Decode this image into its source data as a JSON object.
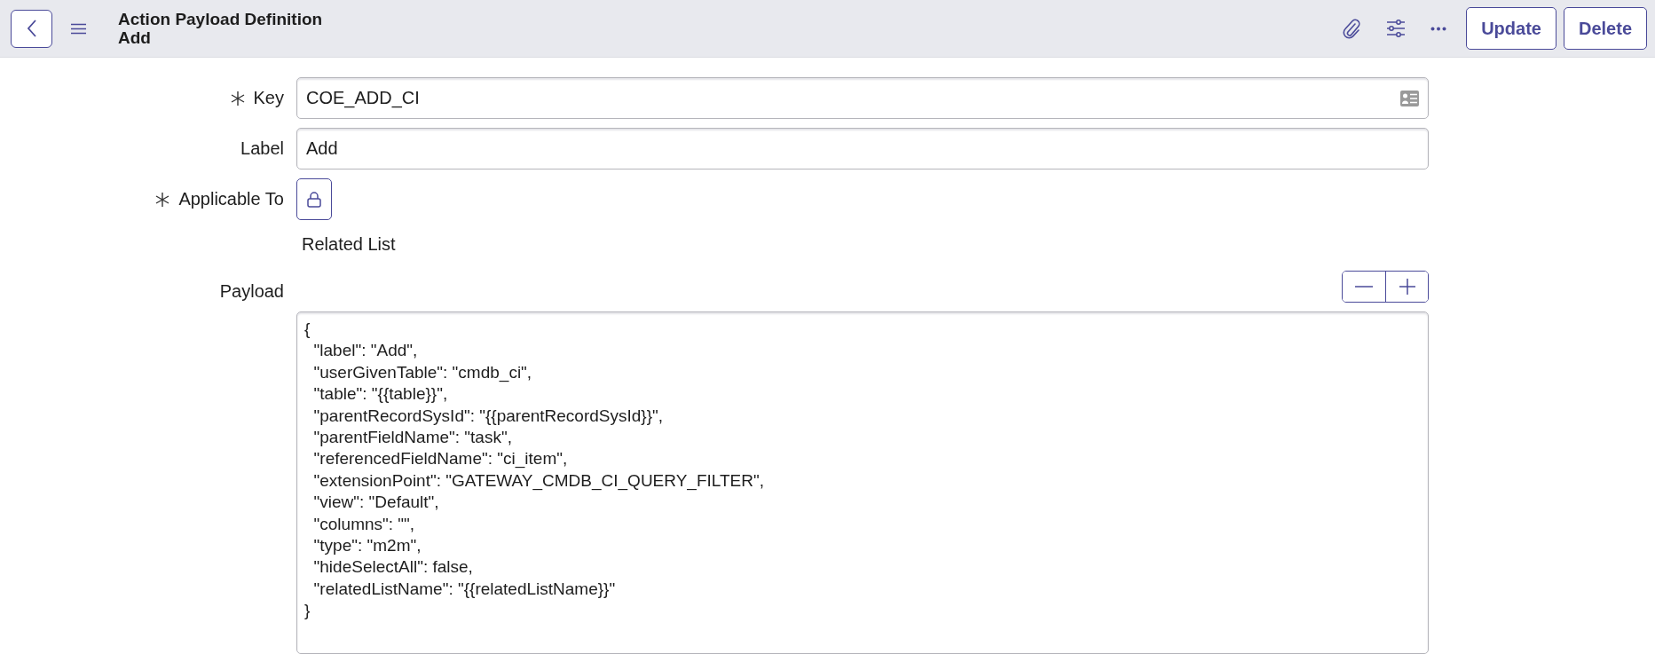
{
  "header": {
    "title": "Action Payload Definition",
    "subtitle": "Add",
    "buttons": [
      "Update",
      "Delete"
    ]
  },
  "fields": [
    {
      "kind": "text",
      "label": "Key",
      "required": true,
      "value": "COE_ADD_CI",
      "show_card": true
    },
    {
      "kind": "text",
      "label": "Label",
      "required": false,
      "value": "Add",
      "show_card": false
    },
    {
      "kind": "locked",
      "label": "Applicable To",
      "required": true,
      "value": "Related List"
    },
    {
      "kind": "code",
      "label": "Payload",
      "required": false,
      "value": "{\n  \"label\": \"Add\",\n  \"userGivenTable\": \"cmdb_ci\",\n  \"table\": \"{{table}}\",\n  \"parentRecordSysId\": \"{{parentRecordSysId}}\",\n  \"parentFieldName\": \"task\",\n  \"referencedFieldName\": \"ci_item\",\n  \"extensionPoint\": \"GATEWAY_CMDB_CI_QUERY_FILTER\",\n  \"view\": \"Default\",\n  \"columns\": \"\",\n  \"type\": \"m2m\",\n  \"hideSelectAll\": false,\n  \"relatedListName\": \"{{relatedListName}}\"\n}"
    }
  ]
}
